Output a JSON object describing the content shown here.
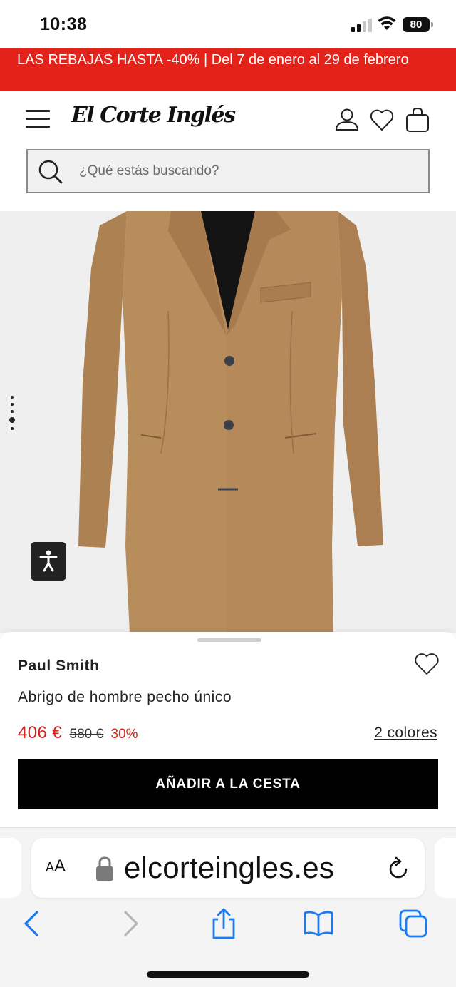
{
  "status_bar": {
    "time": "10:38",
    "battery": "80",
    "icons": [
      "cellular-signal-icon",
      "wifi-icon",
      "battery-icon"
    ]
  },
  "promo_banner": {
    "text": "LAS REBAJAS HASTA -40% | Del 7 de enero al 29 de febrero",
    "background_color": "#e3231a"
  },
  "header": {
    "logo_text": "El Corte Inglés",
    "icons": [
      "menu-icon",
      "account-icon",
      "heart-icon",
      "bag-icon"
    ]
  },
  "search": {
    "placeholder": "¿Qué estás buscando?",
    "value": ""
  },
  "product_image": {
    "description_icon": "camel-coat-image",
    "carousel": {
      "total": 5,
      "active_index": 4
    }
  },
  "accessibility_button": {
    "icon": "accessibility-icon"
  },
  "product": {
    "brand": "Paul Smith",
    "name": "Abrigo de hombre pecho único",
    "price": "406 €",
    "original_price": "580 €",
    "discount": "30%",
    "colors_link": "2 colores",
    "add_to_cart": "AÑADIR A LA CESTA",
    "price_color": "#d4241c"
  },
  "safari": {
    "aa_label_large": "A",
    "aa_label_small": "A",
    "url": "elcorteingles.es",
    "nav_icons": [
      "back-icon",
      "forward-icon",
      "share-icon",
      "bookmarks-icon",
      "tabs-icon"
    ],
    "accent_color": "#1a7cf5"
  }
}
